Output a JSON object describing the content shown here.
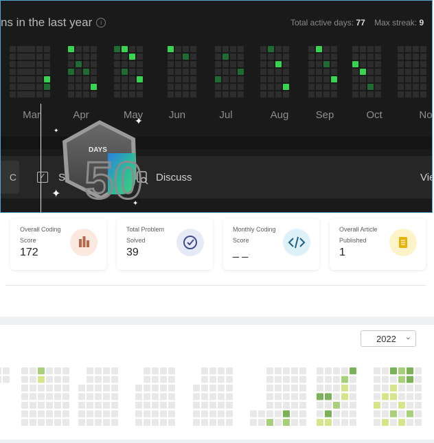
{
  "dark_panel": {
    "title": "ns in the last year",
    "info_icon": "info-icon",
    "stats": {
      "active_days_label": "Total active days:",
      "active_days_value": "77",
      "max_streak_label": "Max streak:",
      "max_streak_value": "9"
    },
    "months": [
      "Mar",
      "Apr",
      "May",
      "Jun",
      "Jul",
      "Aug",
      "Sep",
      "Oct",
      "No"
    ],
    "tabs": [
      {
        "label": "C",
        "icon": ""
      },
      {
        "label": "S",
        "icon": "checkbox-icon"
      },
      {
        "label": "Discuss",
        "icon": "discuss-icon"
      },
      {
        "label": "Vie",
        "icon": ""
      }
    ],
    "badge": {
      "text": "DAYS",
      "number": "50",
      "icon": "fifty-days-badge-icon"
    },
    "colors": {
      "bg": "#1a1a1a",
      "cell": "#2d2d2d",
      "green": "#2ea043",
      "accent": "#57a7d6"
    }
  },
  "stat_cards": [
    {
      "label": "Overall Coding Score",
      "value": "172",
      "icon": "bar-chart-icon",
      "color": "#fbe8de"
    },
    {
      "label": "Total Problem Solved",
      "value": "39",
      "icon": "check-circle-icon",
      "color": "#e6eaf7"
    },
    {
      "label": "Monthly Coding Score",
      "value": "_ _",
      "icon": "code-icon",
      "color": "#dff1f8"
    },
    {
      "label": "Overall Article Published",
      "value": "1",
      "icon": "article-icon",
      "color": "#fdf3c9"
    }
  ],
  "year_select": {
    "value": "2022"
  },
  "light_colors": {
    "empty": "#e8e8e8",
    "level1": "#d7e58a",
    "level2": "#a8d07a",
    "level3": "#7bb159"
  }
}
